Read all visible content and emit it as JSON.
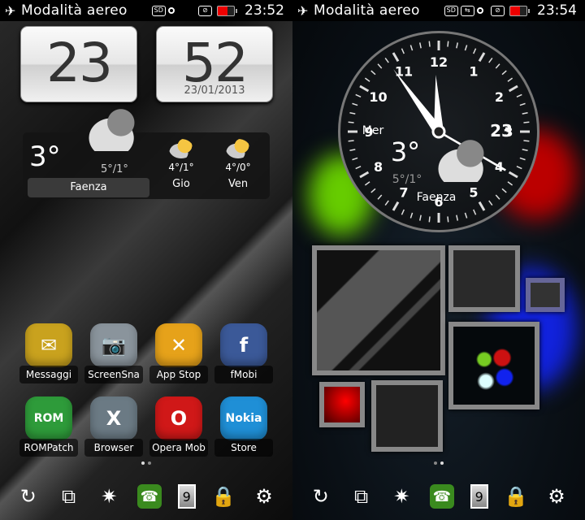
{
  "left": {
    "statusbar": {
      "mode": "Modalità aereo",
      "time": "23:52",
      "icons": [
        "airplane-icon",
        "sd-icon",
        "location-dot-icon",
        "silent-icon",
        "battery-low-icon"
      ]
    },
    "flip_clock": {
      "hour": "23",
      "minute": "52",
      "date": "23/01/2013"
    },
    "weather": {
      "temp": "3°",
      "range": "5°/1°",
      "city": "Faenza",
      "forecast": [
        {
          "day": "Gio",
          "range": "4°/1°"
        },
        {
          "day": "Ven",
          "range": "4°/0°"
        }
      ]
    },
    "apps": [
      {
        "label": "Messaggi",
        "color": "#c9a21e"
      },
      {
        "label": "ScreenSna",
        "color": "#8a949c"
      },
      {
        "label": "App Stop",
        "color": "#e6a21a"
      },
      {
        "label": "fMobi",
        "color": "#3b5998"
      },
      {
        "label": "ROMPatch",
        "color": "#2e9b3a"
      },
      {
        "label": "Browser",
        "color": "#6b7a84"
      },
      {
        "label": "Opera Mob",
        "color": "#d01818"
      },
      {
        "label": "Store",
        "color": "#1f8fd6"
      }
    ],
    "app_glyphs": [
      "✉",
      "📷",
      "✕",
      "f",
      "ROM",
      "X",
      "O",
      "Nokia"
    ]
  },
  "right": {
    "statusbar": {
      "mode": "Modalità aereo",
      "time": "23:54",
      "icons": [
        "airplane-icon",
        "sd-icon",
        "usb-icon",
        "wifi-lock-icon",
        "silent-icon",
        "battery-low-icon"
      ]
    },
    "analog_clock": {
      "numbers": [
        "12",
        "1",
        "2",
        "3",
        "4",
        "5",
        "6",
        "7",
        "8",
        "9",
        "10",
        "11"
      ],
      "day": "Mer",
      "date": "23",
      "temp": "3°",
      "range": "5°/1°",
      "city": "Faenza"
    },
    "tiles": [
      "wallpaper-tile",
      "splash-tile",
      "maze-tile",
      "lights-tile",
      "red-pattern-tile",
      "paint-splash-tile"
    ]
  },
  "dock": {
    "items": [
      "switch-icon",
      "apps-swap-icon",
      "brightness-auto-icon",
      "call-icon",
      "battery-9-icon",
      "lock-icon",
      "settings-gear-icon"
    ],
    "battery_label": "9"
  },
  "pager": {
    "pages": 2
  }
}
